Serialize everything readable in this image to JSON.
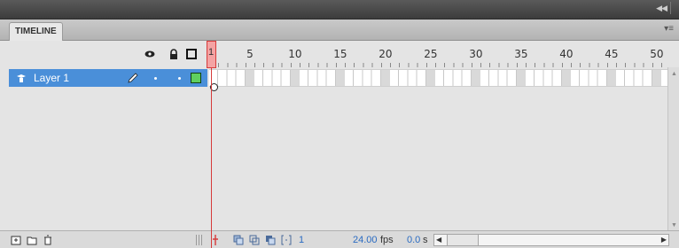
{
  "panel": {
    "title": "TIMELINE"
  },
  "ruler": {
    "labels": [
      "1",
      "5",
      "10",
      "15",
      "20",
      "25",
      "30",
      "35",
      "40",
      "45",
      "50"
    ]
  },
  "layers": [
    {
      "name": "Layer 1",
      "selected": true,
      "outline_color": "#5fcf5f"
    }
  ],
  "playhead": {
    "frame": "1"
  },
  "status": {
    "current_frame": "1",
    "fps_value": "24.00",
    "fps_unit": "fps",
    "time_value": "0.0",
    "time_unit": "s"
  },
  "icons": {
    "header": [
      "eye-icon",
      "lock-icon",
      "outline-icon"
    ],
    "status_left": [
      "new-layer-icon",
      "new-folder-icon",
      "delete-icon"
    ],
    "status_mid": [
      "center-frame-icon",
      "onion-skin-icon",
      "onion-outline-icon",
      "edit-multiple-frames-icon",
      "modify-onion-markers-icon"
    ]
  },
  "colors": {
    "selection": "#4a8fd9",
    "playhead": "#d63b3b",
    "playhead_fill": "#f4a3a3"
  }
}
